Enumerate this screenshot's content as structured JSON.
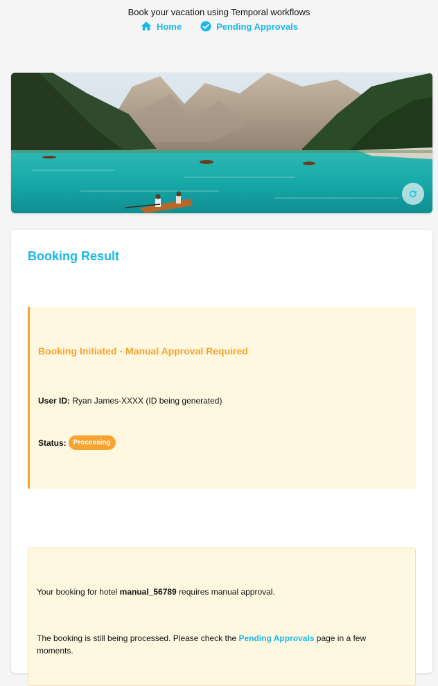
{
  "header": {
    "subtitle": "Book your vacation using Temporal workflows",
    "nav": [
      {
        "label": "Home",
        "icon": "home-icon"
      },
      {
        "label": "Pending Approvals",
        "icon": "check-circle-icon"
      }
    ]
  },
  "hero": {
    "icon": "refresh-icon"
  },
  "result": {
    "title": "Booking Result",
    "notice_heading": "Booking Initiated - Manual Approval Required",
    "user_id_label": "User ID:",
    "user_id_value": "Ryan James-XXXX (ID being generated)",
    "status_label": "Status:",
    "status_badge": "Processing",
    "info_text_1": "Your booking for hotel",
    "hotel_name": "manual_56789",
    "info_text_2": "requires manual approval.",
    "info_text_3": "The booking is still being processed. Please check the",
    "pending_link": "Pending Approvals",
    "info_text_4": "page in a few moments."
  },
  "colors": {
    "accent": "#1ab8e8",
    "warning": "#f7a331",
    "notice_bg": "#fff8e1"
  }
}
